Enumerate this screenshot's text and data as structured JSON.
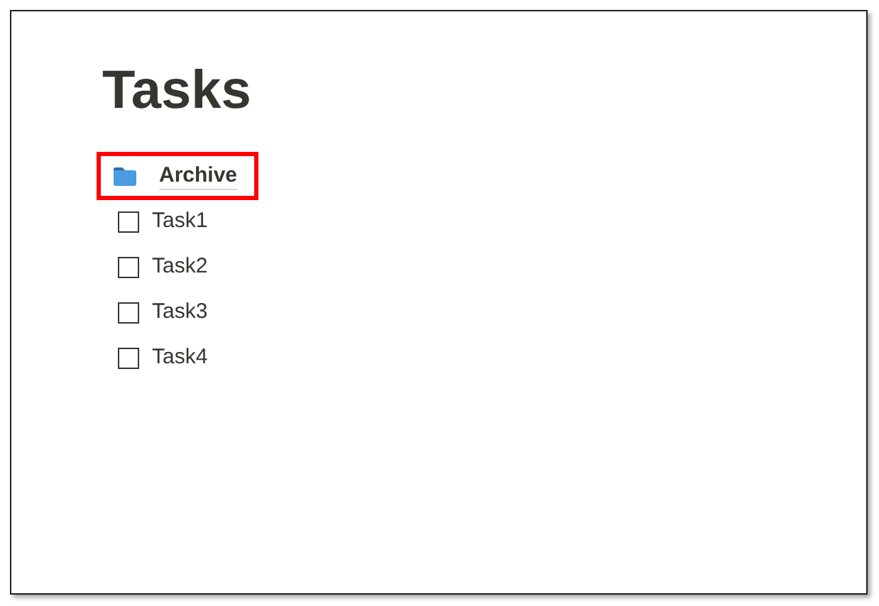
{
  "page": {
    "title": "Tasks"
  },
  "items": [
    {
      "kind": "page",
      "label": "Archive",
      "highlighted": true
    },
    {
      "kind": "todo",
      "label": "Task1",
      "checked": false
    },
    {
      "kind": "todo",
      "label": "Task2",
      "checked": false
    },
    {
      "kind": "todo",
      "label": "Task3",
      "checked": false
    },
    {
      "kind": "todo",
      "label": "Task4",
      "checked": false
    }
  ]
}
